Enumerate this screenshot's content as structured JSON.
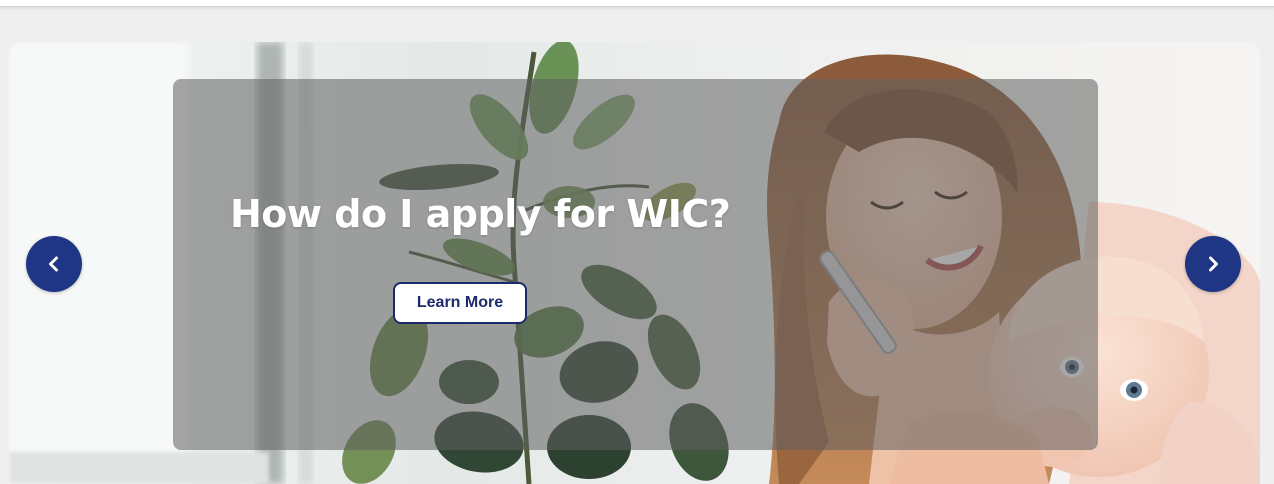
{
  "carousel": {
    "slide": {
      "headline": "How do I apply for WIC?",
      "button_label": "Learn More"
    },
    "prev_icon": "chevron-left-icon",
    "next_icon": "chevron-right-icon"
  },
  "colors": {
    "accent_navy": "#1f3684",
    "button_text": "#1c2a6b",
    "page_background": "#efefef"
  }
}
